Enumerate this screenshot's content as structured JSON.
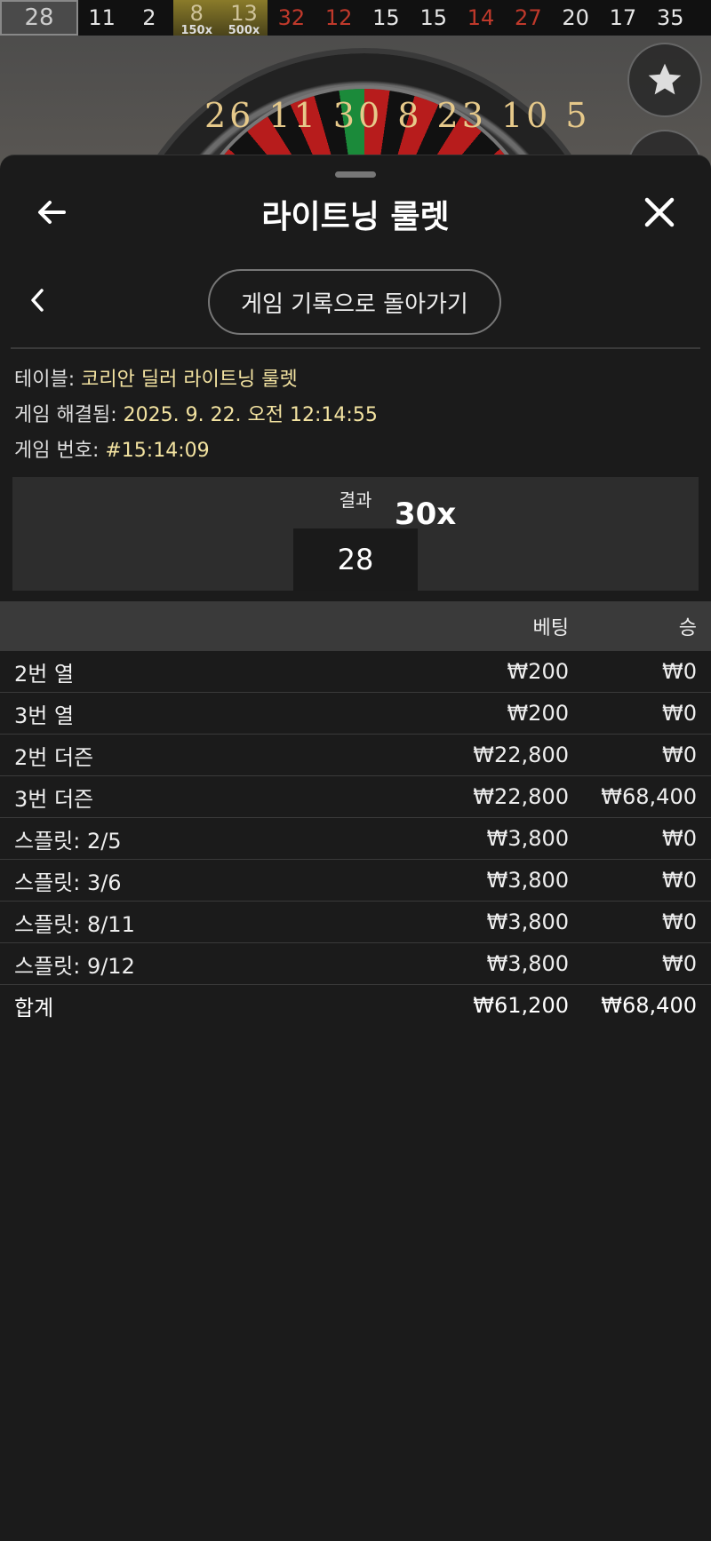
{
  "history": [
    {
      "num": "28",
      "color": "grey"
    },
    {
      "num": "11",
      "color": "black"
    },
    {
      "num": "2",
      "color": "black"
    },
    {
      "num": "8",
      "color": "gold",
      "mult": "150x"
    },
    {
      "num": "13",
      "color": "gold",
      "mult": "500x"
    },
    {
      "num": "32",
      "color": "red"
    },
    {
      "num": "12",
      "color": "red"
    },
    {
      "num": "15",
      "color": "black"
    },
    {
      "num": "15",
      "color": "black"
    },
    {
      "num": "14",
      "color": "red"
    },
    {
      "num": "27",
      "color": "red"
    },
    {
      "num": "20",
      "color": "black"
    },
    {
      "num": "17",
      "color": "black"
    },
    {
      "num": "35",
      "color": "black"
    }
  ],
  "wheel_numbers": "26 11 30 8 23 10 5",
  "header": {
    "title": "라이트닝 룰렛"
  },
  "history_button": "게임 기록으로 돌아가기",
  "info": {
    "table_label": "테이블:",
    "table_value": "코리안 딜러 라이트닝 룰렛",
    "resolved_label": "게임 해결됨:",
    "resolved_value": "2025. 9. 22. 오전 12:14:55",
    "game_no_label": "게임 번호:",
    "game_no_value": "#15:14:09"
  },
  "result": {
    "label": "결과",
    "number": "28",
    "multiplier": "30x"
  },
  "table": {
    "col_bet": "베팅",
    "col_win": "승",
    "rows": [
      {
        "name": "2번 열",
        "bet": "₩200",
        "win": "₩0"
      },
      {
        "name": "3번 열",
        "bet": "₩200",
        "win": "₩0"
      },
      {
        "name": "2번 더즌",
        "bet": "₩22,800",
        "win": "₩0"
      },
      {
        "name": "3번 더즌",
        "bet": "₩22,800",
        "win": "₩68,400"
      },
      {
        "name": "스플릿: 2/5",
        "bet": "₩3,800",
        "win": "₩0"
      },
      {
        "name": "스플릿: 3/6",
        "bet": "₩3,800",
        "win": "₩0"
      },
      {
        "name": "스플릿: 8/11",
        "bet": "₩3,800",
        "win": "₩0"
      },
      {
        "name": "스플릿: 9/12",
        "bet": "₩3,800",
        "win": "₩0"
      }
    ],
    "total": {
      "name": "합계",
      "bet": "₩61,200",
      "win": "₩68,400"
    }
  }
}
